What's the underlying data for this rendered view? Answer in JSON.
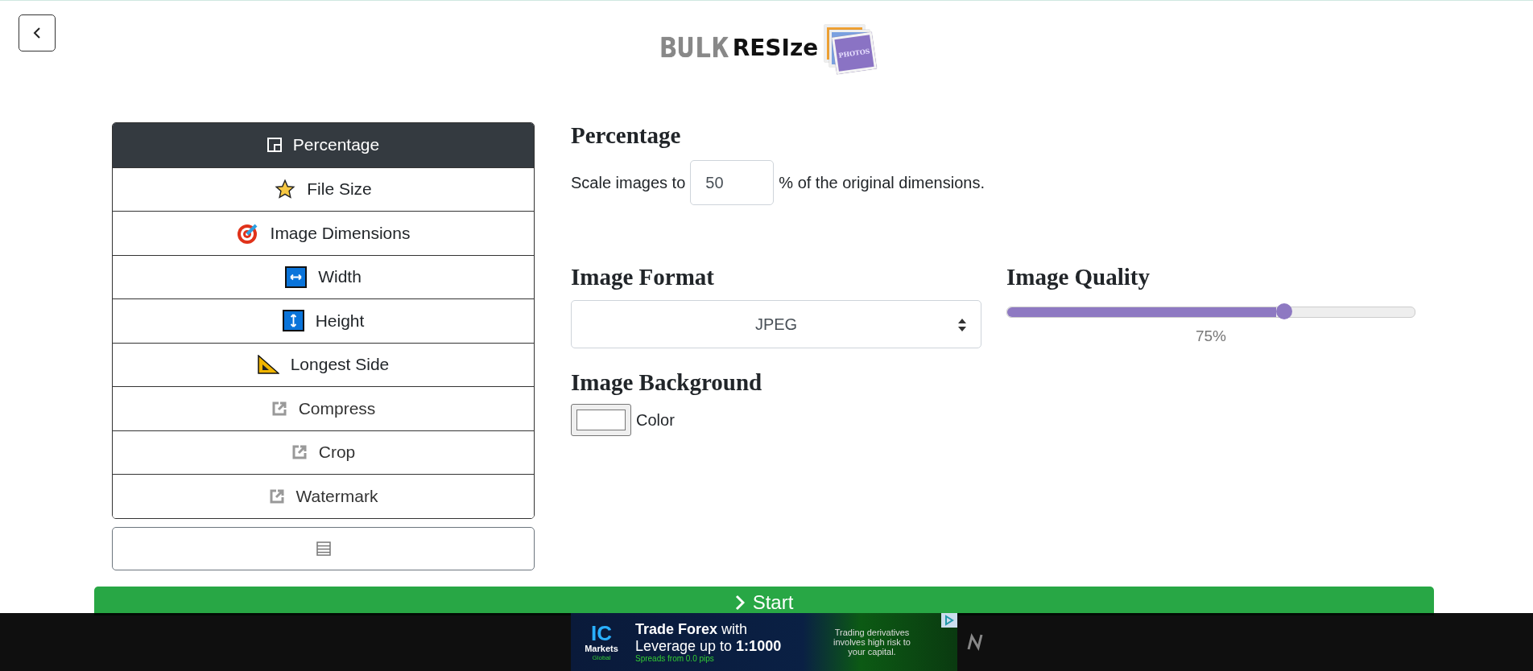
{
  "logo": {
    "word_1": "BULK",
    "word_2": "RESIze",
    "badge": "PHOTOS"
  },
  "modes": [
    {
      "label": "Percentage",
      "kind": "percentage",
      "selected": true
    },
    {
      "label": "File Size",
      "kind": "star",
      "selected": false
    },
    {
      "label": "Image Dimensions",
      "kind": "target",
      "selected": false
    },
    {
      "label": "Width",
      "kind": "width",
      "selected": false
    },
    {
      "label": "Height",
      "kind": "height",
      "selected": false
    },
    {
      "label": "Longest Side",
      "kind": "ruler",
      "selected": false
    },
    {
      "label": "Compress",
      "kind": "external",
      "selected": false
    },
    {
      "label": "Crop",
      "kind": "external",
      "selected": false
    },
    {
      "label": "Watermark",
      "kind": "external",
      "selected": false
    }
  ],
  "panel": {
    "title": "Percentage",
    "before": "Scale images to",
    "value": "50",
    "after": "% of the original dimensions."
  },
  "format": {
    "title": "Image Format",
    "value": "JPEG"
  },
  "quality": {
    "title": "Image Quality",
    "level": 0.68,
    "reading": "75%"
  },
  "background": {
    "title": "Image Background",
    "label": "Color"
  },
  "start": {
    "label": "Start"
  },
  "ad": {
    "brand": "IC",
    "brand_sub": "Markets",
    "brand_sub2": "Global",
    "headline_bold": "Trade Forex",
    "headline": "with",
    "line_2": "Leverage up to",
    "line_2_bold": "1:1000",
    "line_3": "Spreads from 0.0 pips",
    "warning": "Trading derivatives involves high risk to your capital."
  }
}
